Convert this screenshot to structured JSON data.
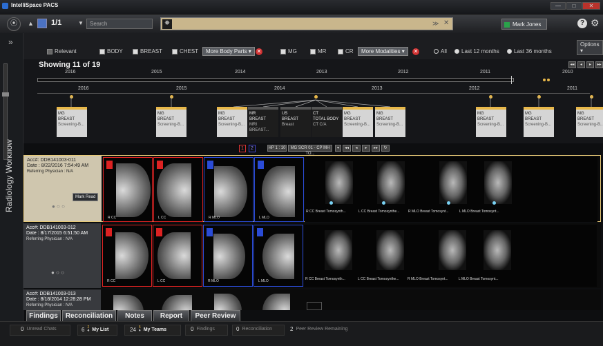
{
  "window": {
    "title": "IntelliSpace PACS"
  },
  "toolbar": {
    "counter": "1/1",
    "search_placeholder": "Search",
    "user": "Mark Jones",
    "help_icon": "help-icon",
    "gear_icon": "gear-icon"
  },
  "sidebar": {
    "label": "Radiology Workflow"
  },
  "filters": {
    "relevant": "Relevant",
    "body": "BODY",
    "breast": "BREAST",
    "chest": "CHEST",
    "more_body_parts": "More Body Parts",
    "mg": "MG",
    "mr": "MR",
    "cr": "CR",
    "more_modalities": "More Modalities",
    "all": "All",
    "last12": "Last 12 months",
    "last36": "Last 36 months",
    "options": "Options"
  },
  "timeline": {
    "showing": "Showing 11 of 19",
    "top_years": [
      "2016",
      "2015",
      "2014",
      "2013",
      "2012",
      "2011",
      "2010"
    ],
    "bottom_years": [
      "2016",
      "2015",
      "2014",
      "2013",
      "2012",
      "2011"
    ]
  },
  "studies": [
    {
      "l1": "MG",
      "l2": "BREAST",
      "l3": "Screening-B...",
      "dark": false
    },
    {
      "l1": "MG",
      "l2": "BREAST",
      "l3": "Screening-B...",
      "dark": false
    },
    {
      "l1": "MG",
      "l2": "BREAST",
      "l3": "Screening-B...",
      "dark": false
    },
    {
      "l1": "MR",
      "l2": "BREAST",
      "l3": "MRI BREAST...",
      "dark": true
    },
    {
      "l1": "US",
      "l2": "BREAST",
      "l3": "Breast",
      "dark": true
    },
    {
      "l1": "CT",
      "l2": "TOTAL BODY",
      "l3": "CT C/A",
      "dark": true
    },
    {
      "l1": "MG",
      "l2": "BREAST",
      "l3": "Screening-B...",
      "dark": false
    },
    {
      "l1": "MG",
      "l2": "BREAST",
      "l3": "Screening-B...",
      "dark": false
    },
    {
      "l1": "MG",
      "l2": "BREAST",
      "l3": "Screening-B...",
      "dark": false
    },
    {
      "l1": "MG",
      "l2": "BREAST",
      "l3": "Screening-B...",
      "dark": false
    },
    {
      "l1": "MG",
      "l2": "BREAST",
      "l3": "Screening-B...",
      "dark": false
    }
  ],
  "nav": {
    "p1": "1",
    "p2": "2",
    "hp": "HP 1 : 10",
    "layout": "MG SCR 01 - CP MH TO..."
  },
  "rows": [
    {
      "acc": "Acc#: DDB141003-011",
      "date": "Date : 8/22/2016 7:54:49 AM",
      "phys": "Referring Physician : N/A",
      "mark": "Mark Read",
      "caps": [
        "R CC",
        "L CC",
        "R MLO",
        "L MLO"
      ],
      "tomo_caps": [
        "R CC Breast Tomosynth...",
        "L CC Breast Tomosynthe...",
        "R MLO Breast Tomosynt...",
        "L MLO Breast Tomosynt..."
      ]
    },
    {
      "acc": "Acc#: DDB141003-012",
      "date": "Date : 8/17/2015 6:51:50 AM",
      "phys": "Referring Physician : N/A",
      "caps": [
        "R CC",
        "L CC",
        "R MLO",
        "L MLO"
      ],
      "tomo_caps": [
        "R CC Breast Tomosynth...",
        "L CC Breast Tomosynthe...",
        "R MLO Breast Tomosynt...",
        "L MLO Breast Tomosynt..."
      ]
    },
    {
      "acc": "Acc#: DDB141003-013",
      "date": "Date : 8/18/2014 12:28:28 PM",
      "phys": "Referring Physician : N/A"
    }
  ],
  "tabs": [
    "Findings",
    "Reconciliation",
    "Notes",
    "Report",
    "Peer Review"
  ],
  "status": {
    "unread_n": "0",
    "unread": "Unread Chats",
    "mylist_n": "6",
    "mylist_sup": "2",
    "mylist_sub": "4",
    "mylist": "My List",
    "myteams_n": "24",
    "myteams_sup": "5",
    "myteams_sub": "4",
    "myteams": "My Teams",
    "findings_n": "0",
    "findings": "Findings",
    "recon_n": "0",
    "recon": "Reconciliation",
    "peer_n": "2",
    "peer": "Peer Review Remaining"
  }
}
